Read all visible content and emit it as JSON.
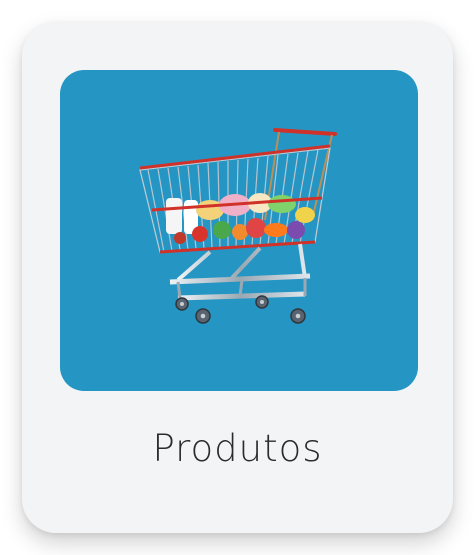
{
  "card": {
    "label": "Produtos",
    "background": "#f3f4f6",
    "tile_color": "#2596c3",
    "icon": "shopping-cart-icon"
  }
}
